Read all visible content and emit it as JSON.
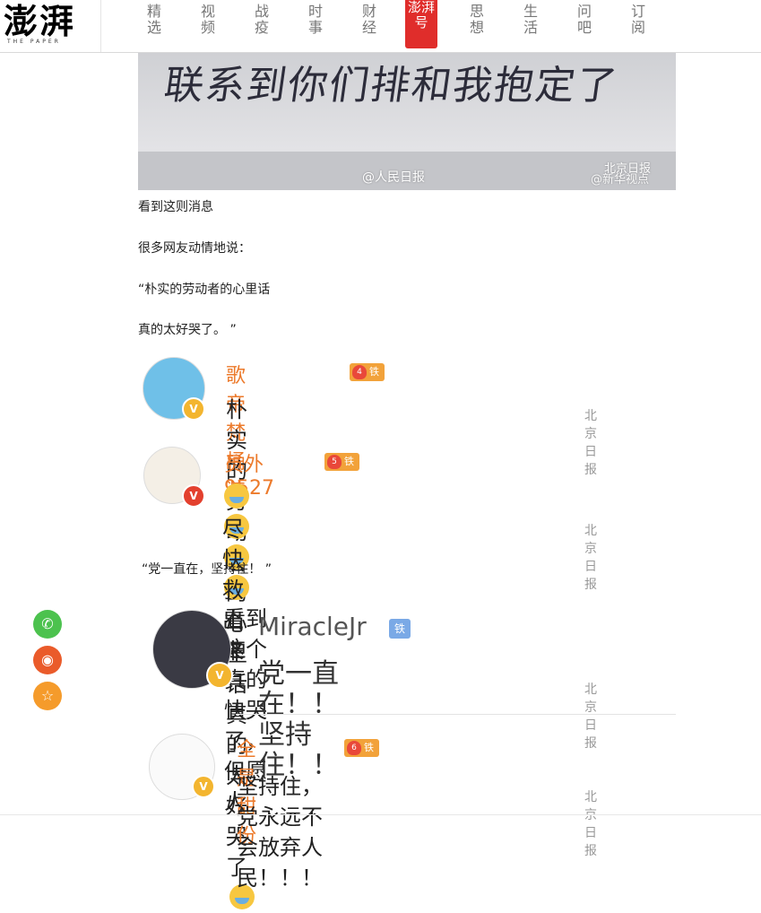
{
  "site": {
    "logo": "澎湃",
    "logo_sub": "THE PAPER",
    "nav": [
      {
        "label": "精选",
        "active": false
      },
      {
        "label": "视频",
        "active": false
      },
      {
        "label": "战疫",
        "active": false
      },
      {
        "label": "时事",
        "active": false
      },
      {
        "label": "财经",
        "active": false
      },
      {
        "label": "澎湃号",
        "active": true
      },
      {
        "label": "思想",
        "active": false
      },
      {
        "label": "生活",
        "active": false
      },
      {
        "label": "问吧",
        "active": false
      },
      {
        "label": "订阅",
        "active": false
      }
    ]
  },
  "hero": {
    "handwriting": "联系到你们排和我抱定了",
    "wm_weibo": "@人民日报",
    "wm_bj": "北京日报",
    "wm_xh": "@新华视点"
  },
  "paras": {
    "p1": "看到这则消息",
    "p2": "很多网友动情地说：",
    "p3": "“朴实的劳动者的心里话",
    "p4": "真的太好哭了。 ”",
    "p5": "“党一直在，坚持住！ ”"
  },
  "comments": [
    {
      "user": "歌帝梵桶装",
      "tag": "铁粉",
      "text": "朴实的劳动者的心里话真的太好哭了",
      "wm": "北京日报"
    },
    {
      "user": "员外9527",
      "tag": "铁粉",
      "text_line1": "看到这个真的快哭了， 但愿人",
      "text_line2": "尽快救出来",
      "wm": "北京日报"
    },
    {
      "user": "MiracleJr",
      "tag": "铁粉",
      "text": "党一直在！！坚持住！！",
      "wm": "北京日报"
    },
    {
      "user": "全是甜份",
      "tag": "铁粉",
      "text": "坚持住，党永远不会放弃人民！！！",
      "wm": "北京日报"
    }
  ],
  "share": {
    "wechat": "wechat-icon",
    "weibo": "weibo-icon",
    "favorite": "star-icon"
  },
  "colors": {
    "accent": "#e02d2b",
    "username": "#ec7a2b",
    "tag": "#f2a23a"
  }
}
